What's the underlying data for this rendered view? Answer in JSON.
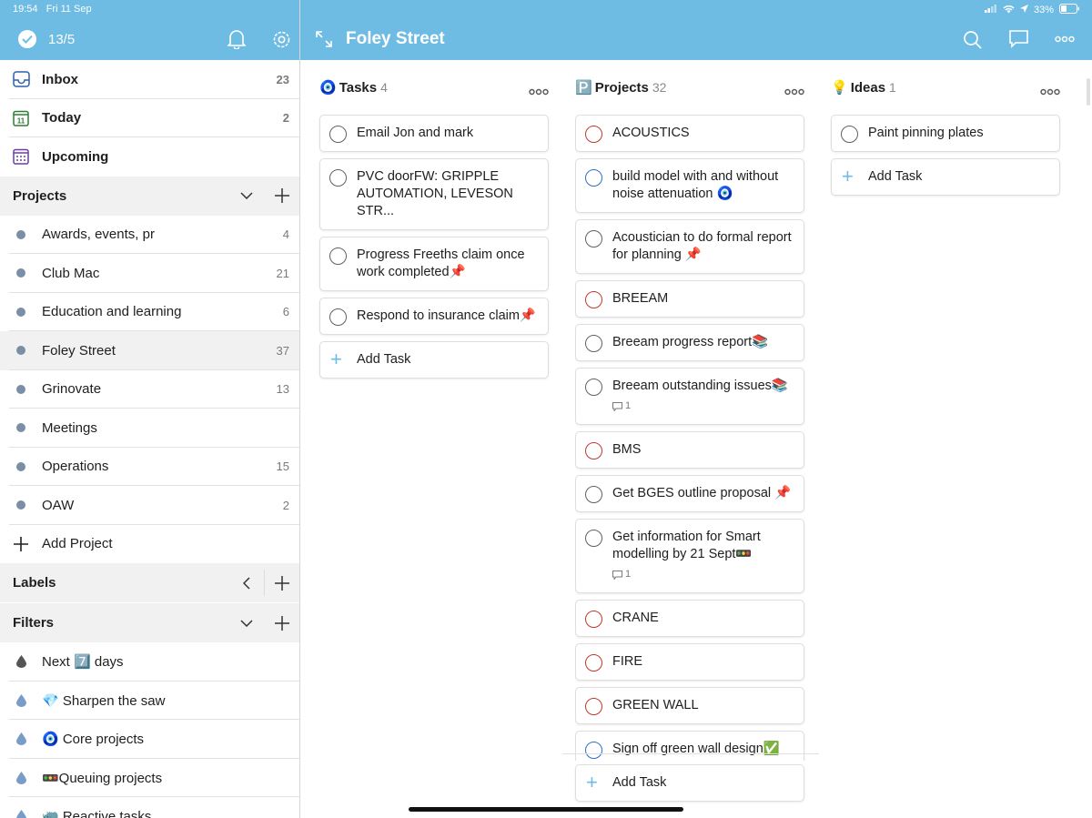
{
  "status": {
    "time": "19:54",
    "date": "Fri 11 Sep",
    "battery": "33%"
  },
  "header": {
    "karma": "13/5",
    "title": "Foley Street"
  },
  "sidebar": {
    "nav": [
      {
        "label": "Inbox",
        "count": "23",
        "icon": "inbox-icon"
      },
      {
        "label": "Today",
        "count": "2",
        "icon": "today-calendar-icon"
      },
      {
        "label": "Upcoming",
        "count": "",
        "icon": "upcoming-calendar-icon"
      }
    ],
    "projects_title": "Projects",
    "projects": [
      {
        "label": "Awards, events, pr",
        "count": "4"
      },
      {
        "label": "Club Mac",
        "count": "21"
      },
      {
        "label": "Education and learning",
        "count": "6"
      },
      {
        "label": "Foley Street",
        "count": "37"
      },
      {
        "label": "Grinovate",
        "count": "13"
      },
      {
        "label": "Meetings",
        "count": ""
      },
      {
        "label": "Operations",
        "count": "15"
      },
      {
        "label": "OAW",
        "count": "2"
      }
    ],
    "add_project": "Add Project",
    "labels_title": "Labels",
    "filters_title": "Filters",
    "filters": [
      {
        "label": "Next 7️⃣ days",
        "color": "#555555"
      },
      {
        "label": "💎 Sharpen the saw",
        "color": "#7a9cc8"
      },
      {
        "label": "🧿 Core projects",
        "color": "#7a9cc8"
      },
      {
        "label": "🚥Queuing projects",
        "color": "#7a9cc8"
      },
      {
        "label": "🦏 Reactive tasks",
        "color": "#7a9cc8"
      }
    ]
  },
  "columns": [
    {
      "emoji": "🧿",
      "title": "Tasks",
      "count": "4",
      "tasks": [
        {
          "text": "Email Jon and mark",
          "ring": "grey"
        },
        {
          "text": "PVC doorFW: GRIPPLE AUTOMATION, LEVESON STR...",
          "ring": "grey"
        },
        {
          "text": "Progress Freeths claim once work completed📌",
          "ring": "grey"
        },
        {
          "text": "Respond to insurance claim📌",
          "ring": "grey"
        }
      ],
      "add_label": "Add Task"
    },
    {
      "emoji": "🅿️",
      "title": "Projects",
      "count": "32",
      "tasks": [
        {
          "text": "ACOUSTICS",
          "ring": "red"
        },
        {
          "text": "build model with and without noise attenuation 🧿",
          "ring": "blue"
        },
        {
          "text": "Acoustician to do formal report for planning  📌",
          "ring": "grey"
        },
        {
          "text": "BREEAM",
          "ring": "red"
        },
        {
          "text": "Breeam progress report📚",
          "ring": "grey"
        },
        {
          "text": "Breeam outstanding issues📚",
          "ring": "grey",
          "comments": "1"
        },
        {
          "text": "BMS",
          "ring": "red"
        },
        {
          "text": "Get BGES outline proposal  📌",
          "ring": "grey"
        },
        {
          "text": "Get information for Smart modelling by 21 Sept🚥",
          "ring": "grey",
          "comments": "1"
        },
        {
          "text": "CRANE",
          "ring": "red"
        },
        {
          "text": "FIRE",
          "ring": "red"
        },
        {
          "text": "GREEN WALL",
          "ring": "red"
        },
        {
          "text": "Sign off green wall design✅",
          "ring": "blue"
        }
      ],
      "add_label": "Add Task"
    },
    {
      "emoji": "💡",
      "title": "Ideas",
      "count": "1",
      "tasks": [
        {
          "text": "Paint pinning plates",
          "ring": "grey"
        }
      ],
      "add_label": "Add Task"
    }
  ]
}
